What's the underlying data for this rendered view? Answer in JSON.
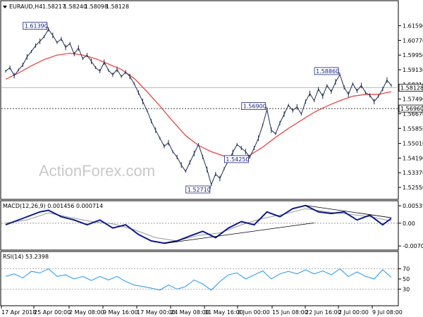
{
  "chart_data": {
    "type": "line",
    "main": {
      "title": "EURAUD,H4",
      "ohlc": [
        "1.58217",
        "1.58240",
        "1.58098",
        "1.58128"
      ],
      "ylim": [
        1.52,
        1.624
      ],
      "yticks": [
        "1.61590",
        "1.60770",
        "1.59950",
        "1.59130",
        "1.58310",
        "1.57490",
        "1.56670",
        "1.55850",
        "1.55010",
        "1.54190",
        "1.53370",
        "1.52550"
      ],
      "price_series": [
        {
          "x": 0,
          "y": 1.5905
        },
        {
          "x": 1,
          "y": 1.5925
        },
        {
          "x": 2,
          "y": 1.588
        },
        {
          "x": 3,
          "y": 1.5912
        },
        {
          "x": 4,
          "y": 1.594
        },
        {
          "x": 5,
          "y": 1.5985
        },
        {
          "x": 6,
          "y": 1.6015
        },
        {
          "x": 7,
          "y": 1.6048
        },
        {
          "x": 8,
          "y": 1.6072
        },
        {
          "x": 9,
          "y": 1.6098
        },
        {
          "x": 10,
          "y": 1.6139
        },
        {
          "x": 11,
          "y": 1.6105
        },
        {
          "x": 12,
          "y": 1.6065
        },
        {
          "x": 13,
          "y": 1.6085
        },
        {
          "x": 14,
          "y": 1.6038
        },
        {
          "x": 15,
          "y": 1.606
        },
        {
          "x": 16,
          "y": 1.6
        },
        {
          "x": 17,
          "y": 1.6035
        },
        {
          "x": 18,
          "y": 1.5975
        },
        {
          "x": 19,
          "y": 1.5995
        },
        {
          "x": 20,
          "y": 1.596
        },
        {
          "x": 21,
          "y": 1.5925
        },
        {
          "x": 22,
          "y": 1.5905
        },
        {
          "x": 23,
          "y": 1.5955
        },
        {
          "x": 24,
          "y": 1.591
        },
        {
          "x": 25,
          "y": 1.5885
        },
        {
          "x": 26,
          "y": 1.5915
        },
        {
          "x": 27,
          "y": 1.5875
        },
        {
          "x": 28,
          "y": 1.59
        },
        {
          "x": 29,
          "y": 1.5875
        },
        {
          "x": 30,
          "y": 1.5835
        },
        {
          "x": 31,
          "y": 1.5785
        },
        {
          "x": 32,
          "y": 1.5735
        },
        {
          "x": 33,
          "y": 1.5685
        },
        {
          "x": 34,
          "y": 1.5625
        },
        {
          "x": 35,
          "y": 1.5575
        },
        {
          "x": 36,
          "y": 1.553
        },
        {
          "x": 37,
          "y": 1.5485
        },
        {
          "x": 38,
          "y": 1.5505
        },
        {
          "x": 39,
          "y": 1.5455
        },
        {
          "x": 40,
          "y": 1.5425
        },
        {
          "x": 41,
          "y": 1.538
        },
        {
          "x": 42,
          "y": 1.5345
        },
        {
          "x": 43,
          "y": 1.5395
        },
        {
          "x": 44,
          "y": 1.5445
        },
        {
          "x": 45,
          "y": 1.5495
        },
        {
          "x": 46,
          "y": 1.5425
        },
        {
          "x": 47,
          "y": 1.5355
        },
        {
          "x": 48,
          "y": 1.5271
        },
        {
          "x": 49,
          "y": 1.533
        },
        {
          "x": 50,
          "y": 1.5305
        },
        {
          "x": 51,
          "y": 1.536
        },
        {
          "x": 52,
          "y": 1.5405
        },
        {
          "x": 53,
          "y": 1.545
        },
        {
          "x": 54,
          "y": 1.5495
        },
        {
          "x": 55,
          "y": 1.5475
        },
        {
          "x": 56,
          "y": 1.5455
        },
        {
          "x": 57,
          "y": 1.5425
        },
        {
          "x": 58,
          "y": 1.5475
        },
        {
          "x": 59,
          "y": 1.553
        },
        {
          "x": 60,
          "y": 1.5605
        },
        {
          "x": 61,
          "y": 1.569
        },
        {
          "x": 62,
          "y": 1.5575
        },
        {
          "x": 63,
          "y": 1.5555
        },
        {
          "x": 64,
          "y": 1.5615
        },
        {
          "x": 65,
          "y": 1.5665
        },
        {
          "x": 66,
          "y": 1.5715
        },
        {
          "x": 67,
          "y": 1.5685
        },
        {
          "x": 68,
          "y": 1.5705
        },
        {
          "x": 69,
          "y": 1.5665
        },
        {
          "x": 70,
          "y": 1.5735
        },
        {
          "x": 71,
          "y": 1.578
        },
        {
          "x": 72,
          "y": 1.574
        },
        {
          "x": 73,
          "y": 1.5805
        },
        {
          "x": 74,
          "y": 1.5765
        },
        {
          "x": 75,
          "y": 1.5825
        },
        {
          "x": 76,
          "y": 1.579
        },
        {
          "x": 77,
          "y": 1.5845
        },
        {
          "x": 78,
          "y": 1.5886
        },
        {
          "x": 79,
          "y": 1.5815
        },
        {
          "x": 80,
          "y": 1.5775
        },
        {
          "x": 81,
          "y": 1.5835
        },
        {
          "x": 82,
          "y": 1.5795
        },
        {
          "x": 83,
          "y": 1.5825
        },
        {
          "x": 84,
          "y": 1.5785
        },
        {
          "x": 85,
          "y": 1.577
        },
        {
          "x": 86,
          "y": 1.5735
        },
        {
          "x": 87,
          "y": 1.5765
        },
        {
          "x": 88,
          "y": 1.5805
        },
        {
          "x": 89,
          "y": 1.5855
        },
        {
          "x": 90,
          "y": 1.5825
        }
      ],
      "ma_series": [
        {
          "x": 0,
          "y": 1.586
        },
        {
          "x": 3,
          "y": 1.5895
        },
        {
          "x": 6,
          "y": 1.5935
        },
        {
          "x": 9,
          "y": 1.597
        },
        {
          "x": 12,
          "y": 1.5995
        },
        {
          "x": 15,
          "y": 1.6005
        },
        {
          "x": 18,
          "y": 1.5995
        },
        {
          "x": 21,
          "y": 1.5975
        },
        {
          "x": 24,
          "y": 1.5945
        },
        {
          "x": 27,
          "y": 1.5915
        },
        {
          "x": 30,
          "y": 1.5865
        },
        {
          "x": 33,
          "y": 1.579
        },
        {
          "x": 36,
          "y": 1.571
        },
        {
          "x": 39,
          "y": 1.5625
        },
        {
          "x": 42,
          "y": 1.5545
        },
        {
          "x": 45,
          "y": 1.549
        },
        {
          "x": 48,
          "y": 1.5455
        },
        {
          "x": 51,
          "y": 1.543
        },
        {
          "x": 54,
          "y": 1.5425
        },
        {
          "x": 57,
          "y": 1.5435
        },
        {
          "x": 60,
          "y": 1.548
        },
        {
          "x": 63,
          "y": 1.5535
        },
        {
          "x": 66,
          "y": 1.5585
        },
        {
          "x": 69,
          "y": 1.563
        },
        {
          "x": 72,
          "y": 1.5675
        },
        {
          "x": 75,
          "y": 1.571
        },
        {
          "x": 78,
          "y": 1.574
        },
        {
          "x": 81,
          "y": 1.5765
        },
        {
          "x": 84,
          "y": 1.5775
        },
        {
          "x": 87,
          "y": 1.5775
        },
        {
          "x": 90,
          "y": 1.579
        }
      ],
      "hlines": [
        {
          "y": 1.5696,
          "label": "1.56960"
        }
      ],
      "current_price": {
        "y": 1.58128,
        "label": "1.58128"
      },
      "annotations": [
        {
          "x": 10,
          "y": 1.6139,
          "label": "1.61390"
        },
        {
          "x": 48,
          "y": 1.5271,
          "label": "1.52710"
        },
        {
          "x": 57,
          "y": 1.5425,
          "label": "1.54250"
        },
        {
          "x": 61,
          "y": 1.569,
          "label": "1.56900"
        },
        {
          "x": 78,
          "y": 1.5886,
          "label": "1.58860"
        }
      ]
    },
    "macd": {
      "title": "MACD(12,26,9) 0.001456 0.000714",
      "ylim": [
        -0.0079,
        0.0063
      ],
      "yticks": [
        "0.005398",
        "0.00",
        "-0.007064"
      ],
      "macd_series": [
        {
          "x": 0,
          "y": -0.0005
        },
        {
          "x": 4,
          "y": 0.0015
        },
        {
          "x": 8,
          "y": 0.0035
        },
        {
          "x": 10,
          "y": 0.004
        },
        {
          "x": 13,
          "y": 0.002
        },
        {
          "x": 16,
          "y": 0.001
        },
        {
          "x": 19,
          "y": -0.0005
        },
        {
          "x": 22,
          "y": 0.001
        },
        {
          "x": 25,
          "y": -0.0015
        },
        {
          "x": 28,
          "y": -0.0005
        },
        {
          "x": 31,
          "y": -0.0035
        },
        {
          "x": 34,
          "y": -0.0055
        },
        {
          "x": 37,
          "y": -0.0062
        },
        {
          "x": 40,
          "y": -0.0055
        },
        {
          "x": 43,
          "y": -0.004
        },
        {
          "x": 46,
          "y": -0.0025
        },
        {
          "x": 49,
          "y": -0.0045
        },
        {
          "x": 52,
          "y": -0.0015
        },
        {
          "x": 55,
          "y": 0.0005
        },
        {
          "x": 58,
          "y": -0.0005
        },
        {
          "x": 61,
          "y": 0.0035
        },
        {
          "x": 64,
          "y": 0.002
        },
        {
          "x": 67,
          "y": 0.0045
        },
        {
          "x": 70,
          "y": 0.0055
        },
        {
          "x": 73,
          "y": 0.0035
        },
        {
          "x": 76,
          "y": 0.003
        },
        {
          "x": 79,
          "y": 0.0035
        },
        {
          "x": 82,
          "y": 0.001
        },
        {
          "x": 85,
          "y": 0.0025
        },
        {
          "x": 88,
          "y": -0.0005
        },
        {
          "x": 90,
          "y": 0.0015
        }
      ],
      "signal_series": [
        {
          "x": 0,
          "y": 0.0
        },
        {
          "x": 5,
          "y": 0.001
        },
        {
          "x": 10,
          "y": 0.0032
        },
        {
          "x": 15,
          "y": 0.0018
        },
        {
          "x": 20,
          "y": 0.0005
        },
        {
          "x": 25,
          "y": -0.0002
        },
        {
          "x": 30,
          "y": -0.002
        },
        {
          "x": 35,
          "y": -0.0045
        },
        {
          "x": 40,
          "y": -0.0055
        },
        {
          "x": 45,
          "y": -0.0038
        },
        {
          "x": 50,
          "y": -0.003
        },
        {
          "x": 55,
          "y": -0.0005
        },
        {
          "x": 60,
          "y": 0.0015
        },
        {
          "x": 65,
          "y": 0.0028
        },
        {
          "x": 70,
          "y": 0.0045
        },
        {
          "x": 75,
          "y": 0.0035
        },
        {
          "x": 80,
          "y": 0.0028
        },
        {
          "x": 85,
          "y": 0.002
        },
        {
          "x": 90,
          "y": 0.0007
        }
      ],
      "trendlines": [
        {
          "from": {
            "x": 37,
            "y": -0.0063
          },
          "to": {
            "x": 72,
            "y": 0.0001
          }
        },
        {
          "from": {
            "x": 70,
            "y": 0.0055
          },
          "to": {
            "x": 90,
            "y": 0.0017
          }
        }
      ]
    },
    "rsi": {
      "title": "RSI(14) 53.2398",
      "ylim": [
        0,
        100
      ],
      "yticks": [
        "70",
        "50",
        "30"
      ],
      "levels": [
        70,
        30
      ],
      "rsi_series": [
        {
          "x": 0,
          "y": 55
        },
        {
          "x": 2,
          "y": 60
        },
        {
          "x": 4,
          "y": 52
        },
        {
          "x": 6,
          "y": 65
        },
        {
          "x": 8,
          "y": 62
        },
        {
          "x": 10,
          "y": 70
        },
        {
          "x": 12,
          "y": 55
        },
        {
          "x": 14,
          "y": 58
        },
        {
          "x": 16,
          "y": 50
        },
        {
          "x": 18,
          "y": 55
        },
        {
          "x": 20,
          "y": 47
        },
        {
          "x": 22,
          "y": 55
        },
        {
          "x": 24,
          "y": 48
        },
        {
          "x": 26,
          "y": 55
        },
        {
          "x": 28,
          "y": 45
        },
        {
          "x": 30,
          "y": 38
        },
        {
          "x": 32,
          "y": 35
        },
        {
          "x": 34,
          "y": 32
        },
        {
          "x": 36,
          "y": 28
        },
        {
          "x": 38,
          "y": 38
        },
        {
          "x": 40,
          "y": 30
        },
        {
          "x": 42,
          "y": 35
        },
        {
          "x": 44,
          "y": 48
        },
        {
          "x": 46,
          "y": 40
        },
        {
          "x": 48,
          "y": 28
        },
        {
          "x": 50,
          "y": 45
        },
        {
          "x": 52,
          "y": 58
        },
        {
          "x": 54,
          "y": 62
        },
        {
          "x": 56,
          "y": 50
        },
        {
          "x": 58,
          "y": 58
        },
        {
          "x": 60,
          "y": 66
        },
        {
          "x": 62,
          "y": 50
        },
        {
          "x": 64,
          "y": 60
        },
        {
          "x": 66,
          "y": 65
        },
        {
          "x": 68,
          "y": 60
        },
        {
          "x": 70,
          "y": 68
        },
        {
          "x": 72,
          "y": 60
        },
        {
          "x": 74,
          "y": 66
        },
        {
          "x": 76,
          "y": 58
        },
        {
          "x": 78,
          "y": 70
        },
        {
          "x": 80,
          "y": 55
        },
        {
          "x": 82,
          "y": 64
        },
        {
          "x": 84,
          "y": 55
        },
        {
          "x": 86,
          "y": 50
        },
        {
          "x": 88,
          "y": 68
        },
        {
          "x": 90,
          "y": 53
        }
      ]
    },
    "xticks": [
      {
        "x": 0,
        "label": "17 Apr 2018"
      },
      {
        "x": 11,
        "label": "25 Apr 00:00"
      },
      {
        "x": 22,
        "label": "2 May 08:00"
      },
      {
        "x": 33,
        "label": "9 May 16:00"
      },
      {
        "x": 45,
        "label": "17 May 00:00"
      },
      {
        "x": 56,
        "label": "24 May 08:00"
      },
      {
        "x": 66,
        "label": "31 May 16:00"
      },
      {
        "x": 74,
        "label": "8 Jun 00:00"
      },
      {
        "x": 80,
        "label": "15 Jun 08:00"
      },
      {
        "x": 85,
        "label": "22 Jun 16:00"
      },
      {
        "x": 89,
        "label": "2 Jul 00:00"
      },
      {
        "x": 90,
        "label": "9 Jul 08:00"
      }
    ],
    "watermark": "ActionForex.com",
    "colors": {
      "price": "#1f2d4e",
      "ma": "#e53935",
      "macd": "#0d1a8c",
      "signal": "#999999",
      "rsi": "#2196f3",
      "annotation": "#1a237e",
      "grid_dotted": "#444444"
    }
  }
}
